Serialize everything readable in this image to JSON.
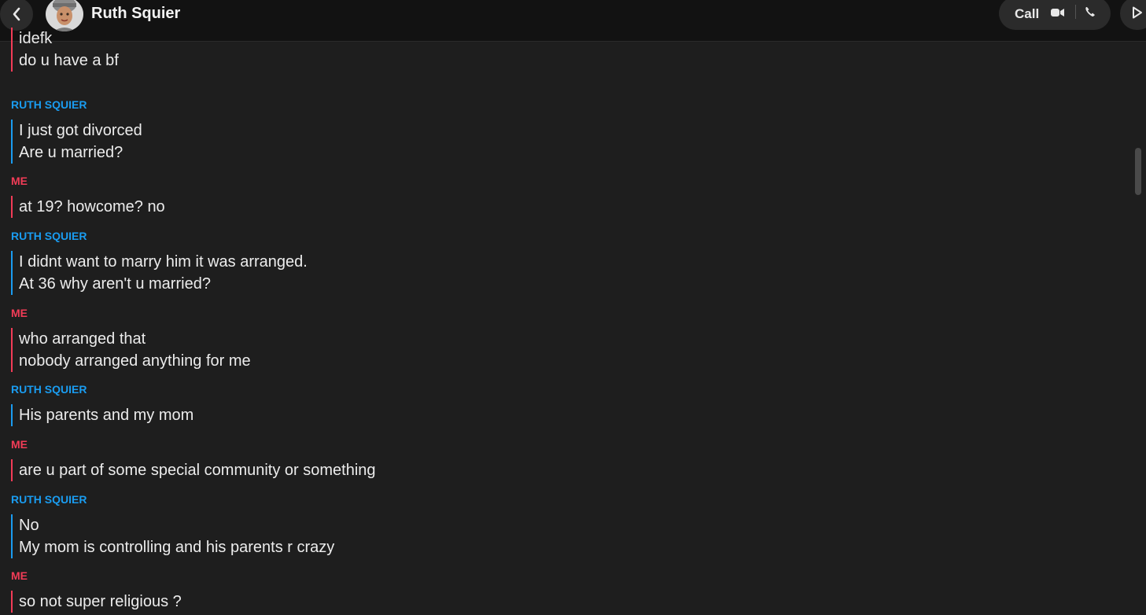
{
  "header": {
    "contact_name": "Ruth Squier",
    "call_label": "Call"
  },
  "colors": {
    "ruth": "#1a9cf0",
    "me": "#f23c57",
    "background": "#1e1e1e"
  },
  "messages": [
    {
      "sender": "",
      "side": "me",
      "lines": [
        "idefk",
        "do u have a bf"
      ]
    },
    {
      "sender": "RUTH SQUIER",
      "side": "ruth",
      "lines": [
        "I just got divorced",
        "Are u married?"
      ]
    },
    {
      "sender": "ME",
      "side": "me",
      "lines": [
        "at 19? howcome? no"
      ]
    },
    {
      "sender": "RUTH SQUIER",
      "side": "ruth",
      "lines": [
        "I didnt want to marry him it was arranged.",
        "At 36 why aren't u married?"
      ]
    },
    {
      "sender": "ME",
      "side": "me",
      "lines": [
        "who arranged that",
        "nobody arranged anything for me"
      ]
    },
    {
      "sender": "RUTH SQUIER",
      "side": "ruth",
      "lines": [
        "His parents and my mom"
      ]
    },
    {
      "sender": "ME",
      "side": "me",
      "lines": [
        "are u part of some special community or something"
      ]
    },
    {
      "sender": "RUTH SQUIER",
      "side": "ruth",
      "lines": [
        "No",
        "My mom is controlling and his parents r crazy"
      ]
    },
    {
      "sender": "ME",
      "side": "me",
      "lines": [
        "so not super religious ?"
      ]
    }
  ]
}
